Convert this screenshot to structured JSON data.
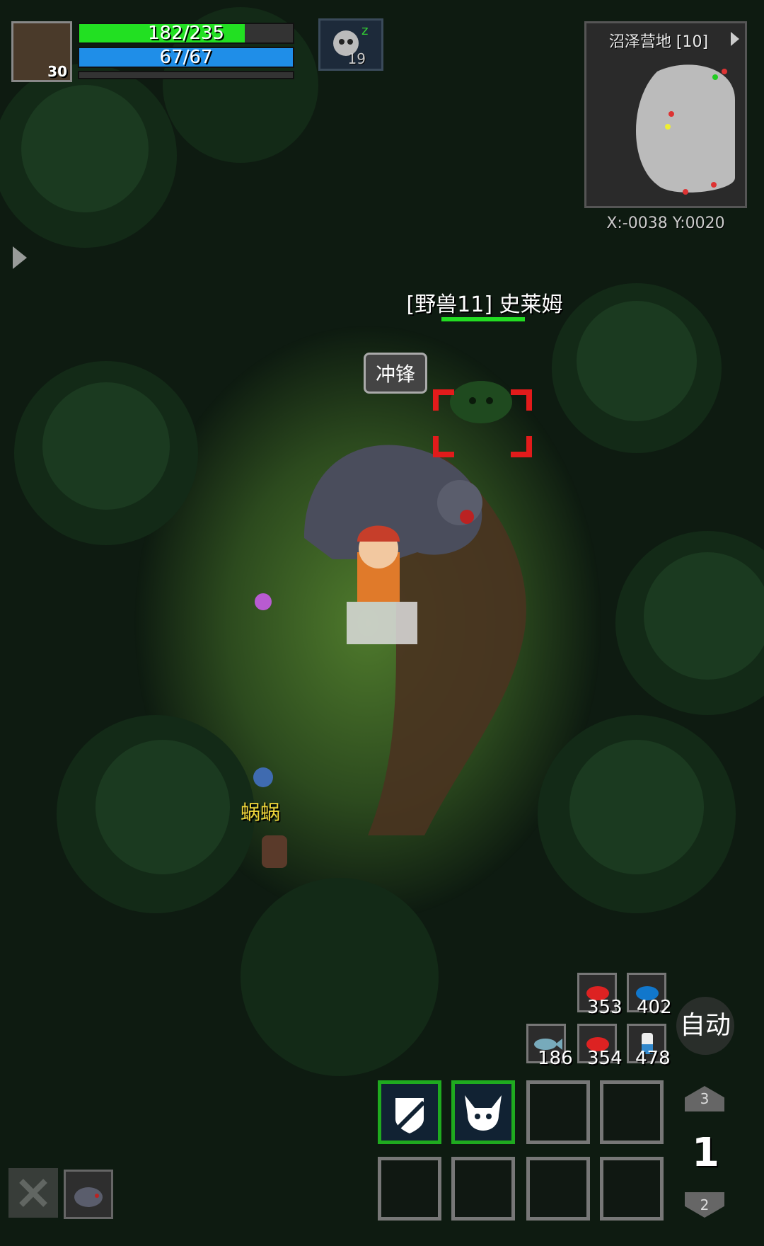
{
  "player": {
    "level": "30",
    "hp_text": "182/235",
    "hp_fraction": 0.774,
    "mp_text": "67/67",
    "mp_fraction": 1.0,
    "colors": {
      "hp": "#22e022",
      "mp": "#1f8ee8"
    }
  },
  "buff": {
    "icon": "skull-sleep-icon",
    "count": "19"
  },
  "minimap": {
    "title": "沼泽营地 [10]",
    "coords": "X:-0038  Y:0020"
  },
  "target": {
    "name": "[野兽11] 史莱姆",
    "hp_fraction": 1.0,
    "action_bubble": "冲锋"
  },
  "npc": {
    "name": "蜗蜗"
  },
  "consumables": [
    {
      "icon": "red-meat-icon",
      "count": "353"
    },
    {
      "icon": "blue-meat-icon",
      "count": "402"
    },
    {
      "icon": "fish-icon",
      "count": "186"
    },
    {
      "icon": "red-meat-icon",
      "count": "354"
    },
    {
      "icon": "potion-icon",
      "count": "478"
    }
  ],
  "auto_label": "自动",
  "skill_page": {
    "current": "1",
    "up": "3",
    "down": "2"
  },
  "skills": [
    {
      "icon": "shield-slash-icon",
      "active": true
    },
    {
      "icon": "beast-skull-icon",
      "active": true
    },
    {
      "icon": "",
      "active": false
    },
    {
      "icon": "",
      "active": false
    },
    {
      "icon": "",
      "active": false
    },
    {
      "icon": "",
      "active": false
    },
    {
      "icon": "",
      "active": false
    },
    {
      "icon": "",
      "active": false
    }
  ],
  "bottom_left": [
    {
      "icon": "close-icon"
    },
    {
      "icon": "bear-pet-icon"
    }
  ]
}
